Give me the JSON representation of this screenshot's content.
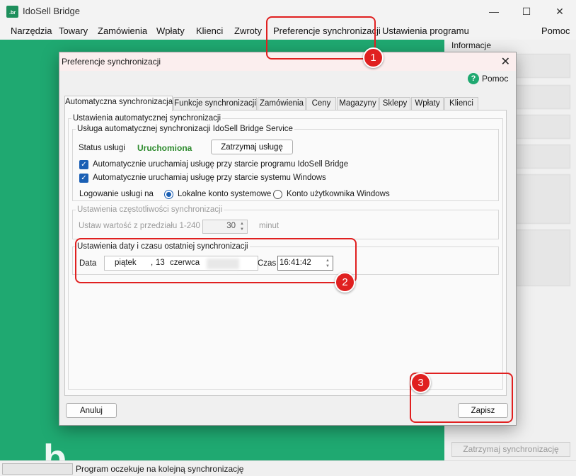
{
  "app": {
    "title": "IdoSell Bridge",
    "icon_text": ".br",
    "controls": {
      "minimize": "—",
      "maximize": "☐",
      "close": "✕"
    }
  },
  "menu": {
    "items": [
      "Narzędzia",
      "Towary",
      "Zamówienia",
      "Wpłaty",
      "Klienci",
      "Zwroty",
      "Preferencje synchronizacji",
      "Ustawienia programu",
      "Pomoc"
    ]
  },
  "background": {
    "logo_text": ".b",
    "info_label": "Informacje",
    "stop_sync_button": "Zatrzymaj synchronizację",
    "status_text": "Program oczekuje na kolejną synchronizację"
  },
  "dialog": {
    "title": "Preferencje synchronizacji",
    "close": "✕",
    "help_label": "Pomoc",
    "help_icon": "?",
    "tabs": [
      "Automatyczna synchronizacja",
      "Funkcje synchronizacji",
      "Zamówienia",
      "Ceny",
      "Magazyny",
      "Sklepy",
      "Wpłaty",
      "Klienci"
    ],
    "active_tab": "Automatyczna synchronizacja",
    "auto_group": {
      "legend": "Ustawienia automatycznej synchronizacji",
      "service_group": {
        "legend": "Usługa automatycznej synchronizacji IdoSell Bridge Service",
        "status_label": "Status usługi",
        "status_value": "Uruchomiona",
        "stop_service_button": "Zatrzymaj usługę",
        "check1": "Automatycznie uruchamiaj usługę przy starcie programu IdoSell Bridge",
        "check1_checked": true,
        "check2": "Automatycznie uruchamiaj usługę przy starcie systemu Windows",
        "check2_checked": true,
        "logon_label": "Logowanie usługi na",
        "radio1": "Lokalne konto systemowe",
        "radio1_selected": true,
        "radio2": "Konto użytkownika Windows",
        "radio2_selected": false
      },
      "frequency_group": {
        "legend": "Ustawienia częstotliwości synchronizacji",
        "label": "Ustaw wartość z przedziału 1-240",
        "value": "30",
        "unit": "minut"
      },
      "last_sync_group": {
        "legend": "Ustawienia daty i czasu ostatniej synchronizacji",
        "date_label": "Data",
        "date_weekday": "piątek",
        "date_comma": ",",
        "date_day": "13",
        "date_month": "czerwca",
        "time_label": "Czas",
        "time_value": "16:41:42"
      }
    },
    "cancel_button": "Anuluj",
    "save_button": "Zapisz"
  },
  "annotations": {
    "badge1": "1",
    "badge2": "2",
    "badge3": "3",
    "color": "#e02020"
  }
}
